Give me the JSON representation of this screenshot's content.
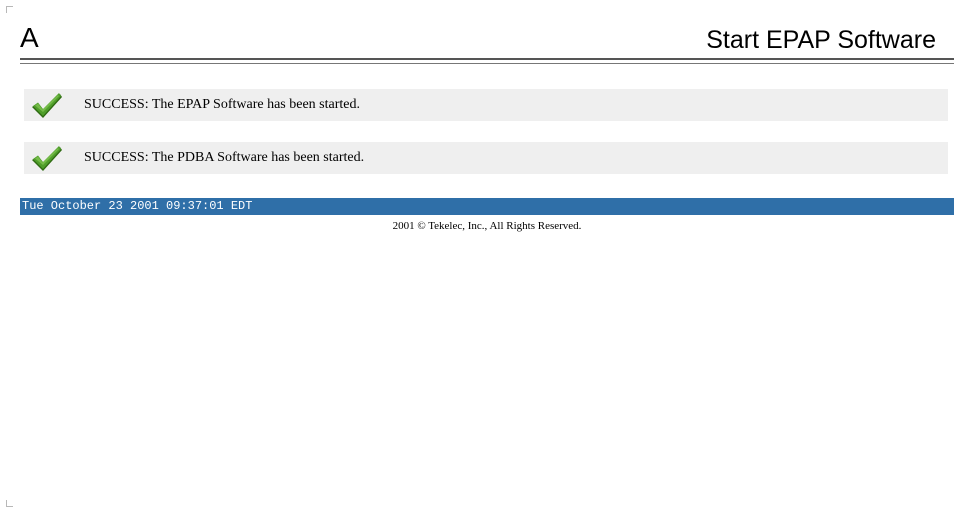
{
  "header": {
    "area_letter": "A",
    "title": "Start EPAP Software"
  },
  "messages": [
    {
      "icon": "checkmark-icon",
      "text": "SUCCESS: The EPAP Software has been started."
    },
    {
      "icon": "checkmark-icon",
      "text": "SUCCESS: The PDBA Software has been started."
    }
  ],
  "status_bar": {
    "datetime": "Tue October 23 2001 09:37:01 EDT"
  },
  "footer": {
    "copyright": "2001 © Tekelec, Inc., All Rights Reserved."
  },
  "colors": {
    "status_bar_bg": "#2f6fa8",
    "message_row_bg": "#efefef",
    "check_green": "#3f8a1e"
  }
}
